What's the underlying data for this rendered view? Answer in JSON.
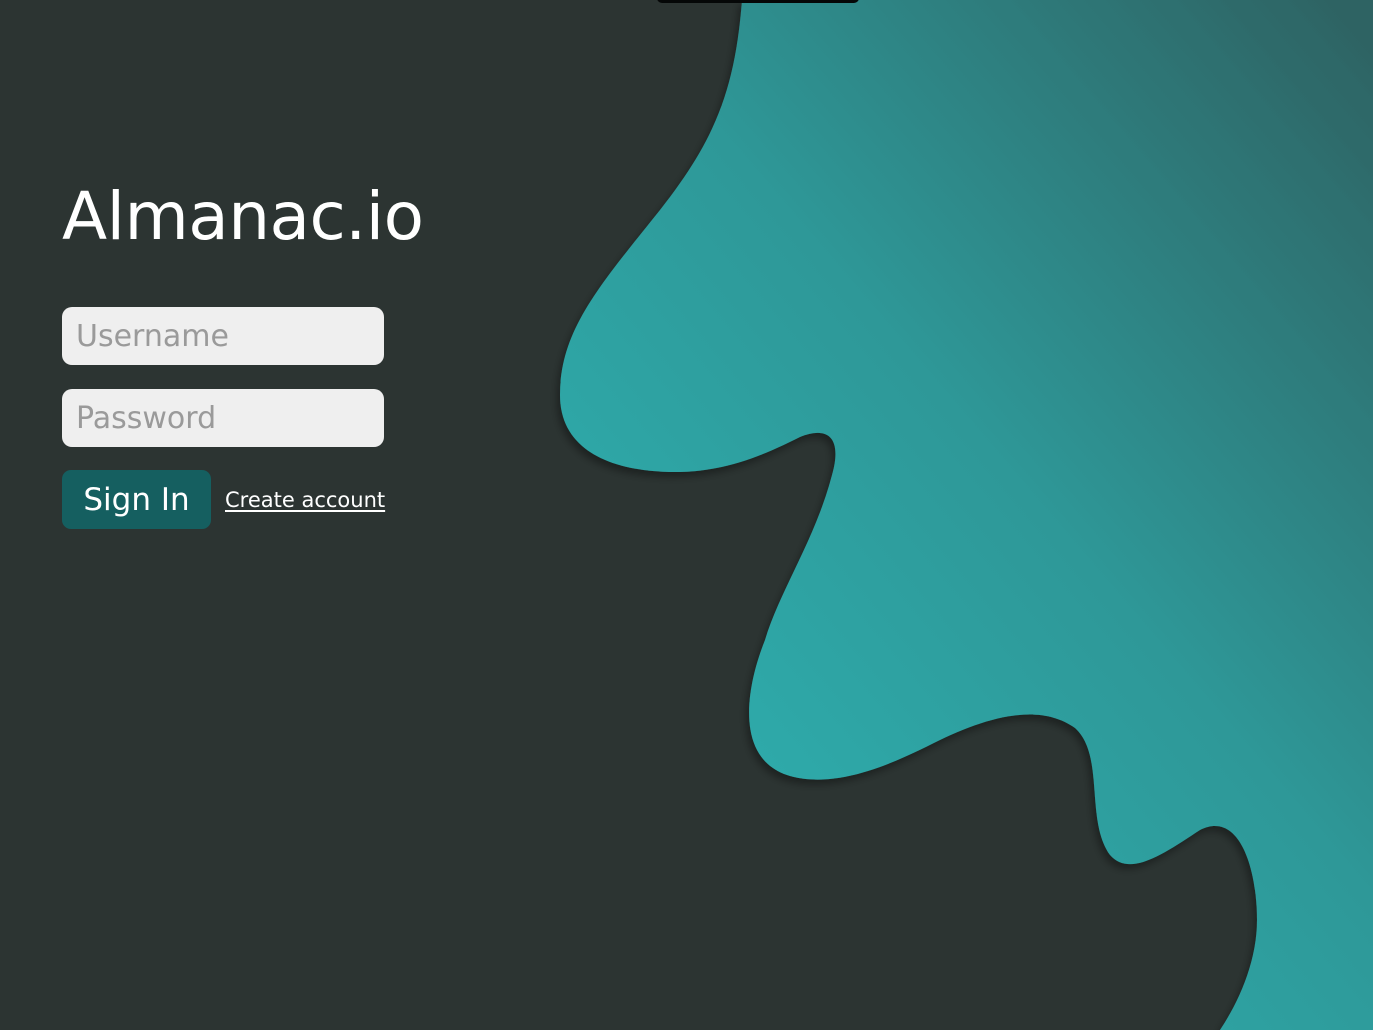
{
  "brand": {
    "title": "Almanac.io"
  },
  "login_form": {
    "username_placeholder": "Username",
    "username_value": "",
    "password_placeholder": "Password",
    "password_value": "",
    "sign_in_label": "Sign In",
    "create_account_label": "Create account"
  },
  "theme": {
    "background": "#2c3432",
    "accent_teal": "#2ea8aa",
    "accent_teal_dark": "#2e6262",
    "button_color": "#155f60",
    "input_background": "#efefef"
  }
}
